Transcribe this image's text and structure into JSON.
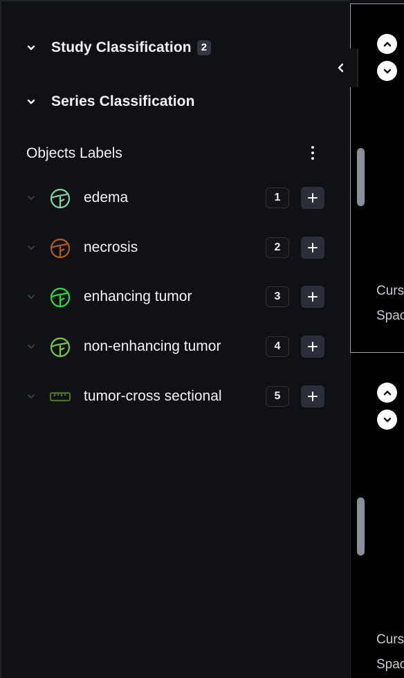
{
  "sidebar": {
    "study_classification": {
      "title": "Study Classification",
      "badge": "2"
    },
    "series_classification": {
      "title": "Series Classification"
    },
    "objects_labels": {
      "title": "Objects Labels",
      "items": [
        {
          "name": "edema",
          "count": "1",
          "icon": "brush-icon",
          "color": "#7fd6a3"
        },
        {
          "name": "necrosis",
          "count": "2",
          "icon": "brush-icon",
          "color": "#b35a22"
        },
        {
          "name": "enhancing tumor",
          "count": "3",
          "icon": "brush-icon",
          "color": "#22e040"
        },
        {
          "name": "non-enhancing tumor",
          "count": "4",
          "icon": "brush-icon",
          "color": "#7cc83a"
        },
        {
          "name": "tumor-cross sectional",
          "count": "5",
          "icon": "ruler-icon",
          "color": "#4f6e2c"
        }
      ]
    }
  },
  "viewports": [
    {
      "overlay_lines": [
        "Curs",
        "Spac"
      ]
    },
    {
      "overlay_lines": [
        "Curs",
        "Spac"
      ]
    }
  ],
  "colors": {
    "background": "#0f1115",
    "accent_button": "#2a2f39",
    "badge": "#303642"
  }
}
